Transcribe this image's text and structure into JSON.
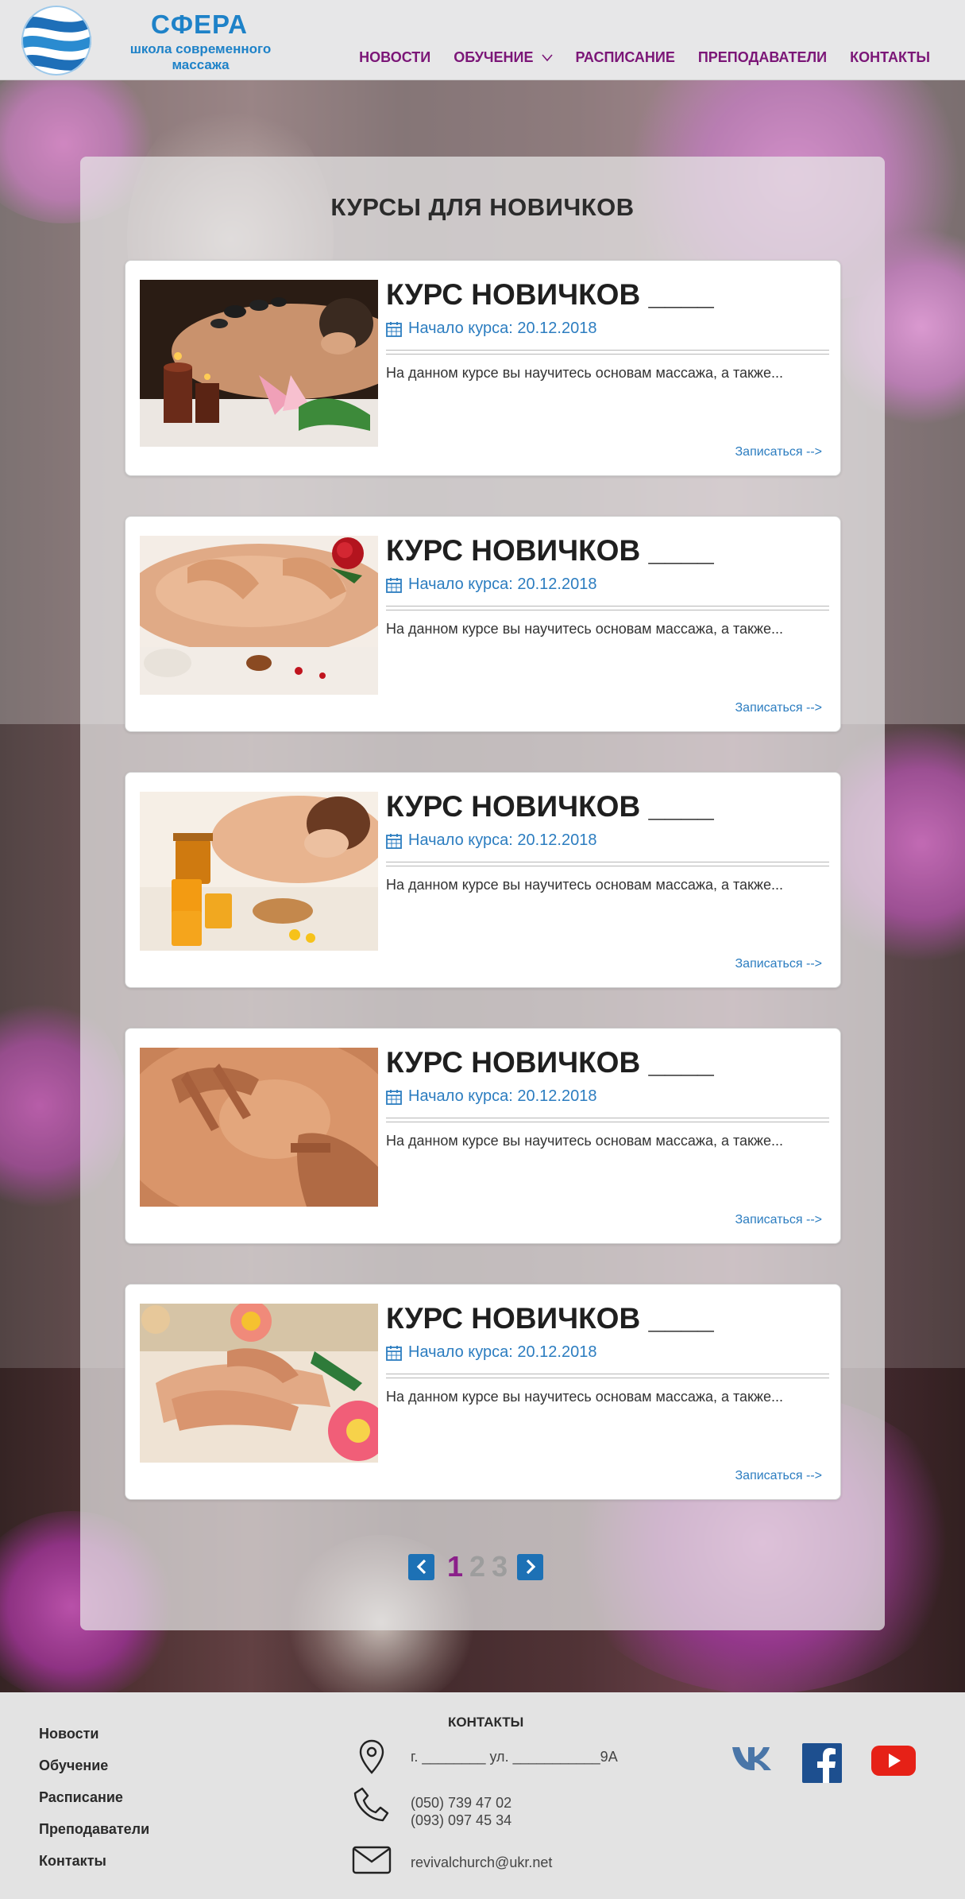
{
  "header": {
    "logo_title": "СФЕРА",
    "logo_sub_line1": "школа современного",
    "logo_sub_line2": "массажа",
    "nav": [
      {
        "label": "НОВОСТИ"
      },
      {
        "label": "ОБУЧЕНИЕ"
      },
      {
        "label": "РАСПИСАНИЕ"
      },
      {
        "label": "ПРЕПОДАВАТЕЛИ"
      },
      {
        "label": "КОНТАКТЫ"
      }
    ]
  },
  "main": {
    "section_title": "КУРСЫ ДЛЯ НОВИЧКОВ",
    "courses": [
      {
        "title": "КУРС НОВИЧКОВ ____",
        "date": "Начало курса: 20.12.2018",
        "desc": "На данном курсе вы научитесь основам массажа, а также...",
        "link": "Записаться -->",
        "image": "hot-stone-massage"
      },
      {
        "title": "КУРС НОВИЧКОВ ____",
        "date": "Начало курса: 20.12.2018",
        "desc": "На данном курсе вы научитесь основам массажа, а также...",
        "link": "Записаться -->",
        "image": "back-massage-rose"
      },
      {
        "title": "КУРС НОВИЧКОВ ____",
        "date": "Начало курса: 20.12.2018",
        "desc": "На данном курсе вы научитесь основам массажа, а также...",
        "link": "Записаться -->",
        "image": "honey-massage"
      },
      {
        "title": "КУРС НОВИЧКОВ ____",
        "date": "Начало курса: 20.12.2018",
        "desc": "На данном курсе вы научитесь основам массажа, а также...",
        "link": "Записаться -->",
        "image": "hands-on-back"
      },
      {
        "title": "КУРС НОВИЧКОВ ____",
        "date": "Начало курса: 20.12.2018",
        "desc": "На данном курсе вы научитесь основам массажа, а также...",
        "link": "Записаться -->",
        "image": "hand-massage-lotus"
      }
    ],
    "pagination": {
      "pages": [
        "1",
        "2",
        "3"
      ],
      "current": "1"
    }
  },
  "footer": {
    "links": [
      {
        "label": "Новости"
      },
      {
        "label": "Обучение"
      },
      {
        "label": "Расписание"
      },
      {
        "label": "Преподаватели"
      },
      {
        "label": "Контакты"
      }
    ],
    "contacts_title": "КОНТАКТЫ",
    "address": "г. ________ ул. ___________9А",
    "phone1": "(050) 739 47 02",
    "phone2": "(093) 097 45 34",
    "email": "revivalchurch@ukr.net",
    "social": [
      "vk-icon",
      "facebook-icon",
      "youtube-icon"
    ]
  },
  "colors": {
    "brand_blue": "#1e82c8",
    "nav_purple": "#7b1677",
    "link_blue": "#2c7dc0",
    "pager_active": "#8b1f8a",
    "vk": "#4a76a8",
    "facebook": "#1d4f8f",
    "youtube": "#e62117"
  }
}
